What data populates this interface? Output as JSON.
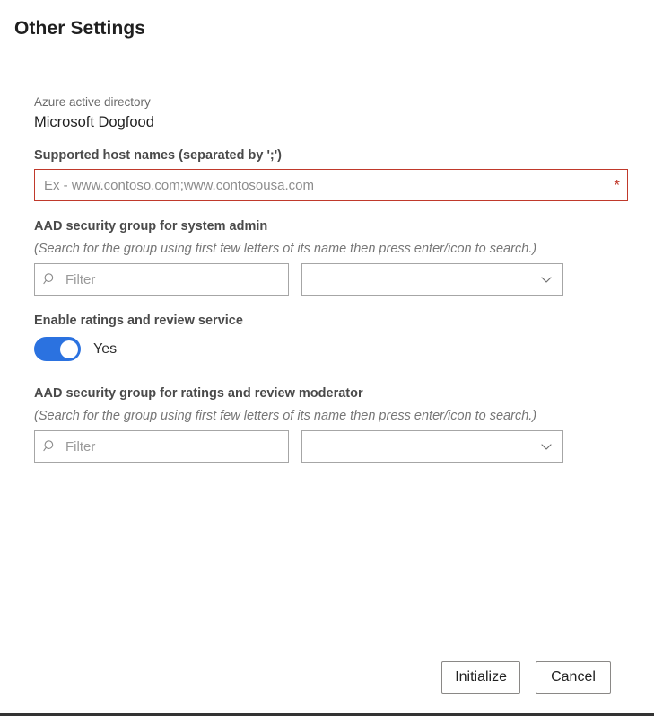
{
  "page": {
    "title": "Other Settings"
  },
  "aad": {
    "caption": "Azure active directory",
    "tenant": "Microsoft Dogfood"
  },
  "fields": {
    "hostnames": {
      "label": "Supported host names (separated by ';')",
      "placeholder": "Ex - www.contoso.com;www.contosousa.com",
      "value": "",
      "required_marker": "*",
      "required": true,
      "border_color": "#c0392b"
    },
    "admin_group": {
      "label": "AAD security group for system admin",
      "hint": "(Search for the group using first few letters of its name then press enter/icon to search.)",
      "filter_placeholder": "Filter",
      "filter_value": "",
      "selected_option": "",
      "search_icon": "search-icon",
      "chevron_icon": "chevron-down-icon"
    },
    "ratings_toggle": {
      "label": "Enable ratings and review service",
      "state_text": "Yes",
      "checked": true,
      "on_color": "#2b72e0"
    },
    "moderator_group": {
      "label": "AAD security group for ratings and review moderator",
      "hint": "(Search for the group using first few letters of its name then press enter/icon to search.)",
      "filter_placeholder": "Filter",
      "filter_value": "",
      "selected_option": "",
      "search_icon": "search-icon",
      "chevron_icon": "chevron-down-icon"
    }
  },
  "footer": {
    "primary_label": "Initialize",
    "secondary_label": "Cancel"
  }
}
